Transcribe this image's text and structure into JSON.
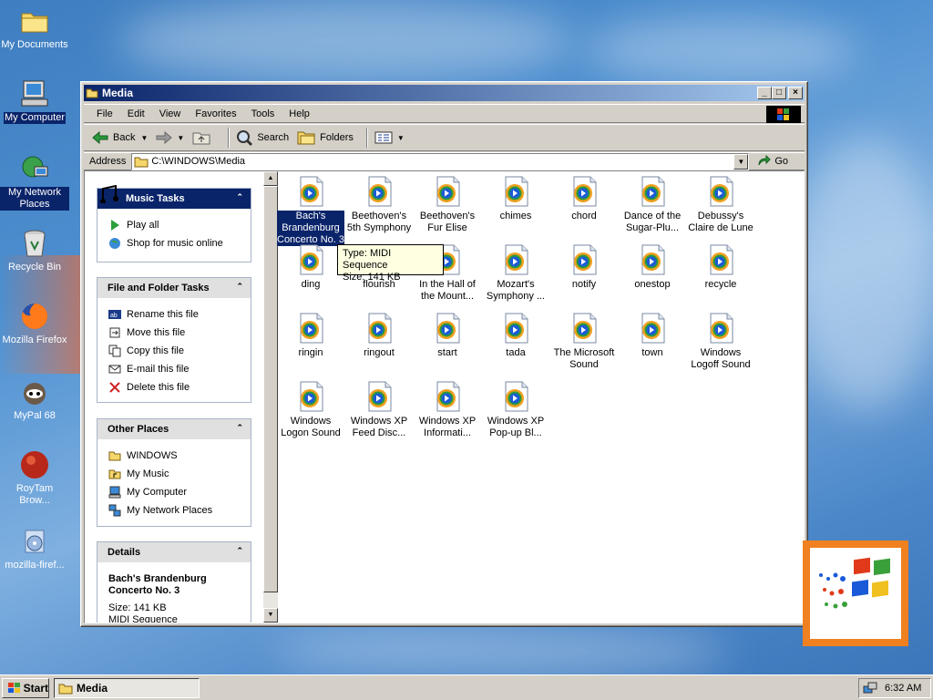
{
  "desktop": {
    "icons": [
      {
        "label": "My Documents",
        "icon": "folder-icon"
      },
      {
        "label": "My Computer",
        "icon": "computer-icon"
      },
      {
        "label": "My Network Places",
        "icon": "network-icon"
      },
      {
        "label": "Recycle Bin",
        "icon": "recycle-bin-icon"
      },
      {
        "label": "Mozilla Firefox",
        "icon": "firefox-icon"
      },
      {
        "label": "MyPal 68",
        "icon": "mypal-icon"
      },
      {
        "label": "RoyTam Brow...",
        "icon": "roytam-icon"
      },
      {
        "label": "mozilla-firef...",
        "icon": "installer-icon"
      }
    ]
  },
  "window": {
    "title": "Media",
    "menu": [
      "File",
      "Edit",
      "View",
      "Favorites",
      "Tools",
      "Help"
    ],
    "toolbar": {
      "back": "Back",
      "search": "Search",
      "folders": "Folders"
    },
    "address": {
      "label": "Address",
      "value": "C:\\WINDOWS\\Media",
      "go": "Go"
    }
  },
  "tasks": {
    "music": {
      "title": "Music Tasks",
      "items": [
        "Play all",
        "Shop for music online"
      ]
    },
    "file": {
      "title": "File and Folder Tasks",
      "items": [
        "Rename this file",
        "Move this file",
        "Copy this file",
        "E-mail this file",
        "Delete this file"
      ]
    },
    "other": {
      "title": "Other Places",
      "items": [
        "WINDOWS",
        "My Music",
        "My Computer",
        "My Network Places"
      ]
    },
    "details": {
      "title": "Details",
      "name": "Bach's Brandenburg Concerto No. 3",
      "size": "Size: 141 KB",
      "type": "MIDI Sequence"
    }
  },
  "files": [
    "Bach's Brandenburg Concerto No. 3",
    "Beethoven's 5th Symphony",
    "Beethoven's Fur Elise",
    "chimes",
    "chord",
    "Dance of the Sugar-Plu...",
    "Debussy's Claire de Lune",
    "ding",
    "flourish",
    "In the Hall of the Mount...",
    "Mozart's Symphony ...",
    "notify",
    "onestop",
    "recycle",
    "ringin",
    "ringout",
    "start",
    "tada",
    "The Microsoft Sound",
    "town",
    "Windows Logoff Sound",
    "Windows Logon Sound",
    "Windows XP Feed Disc...",
    "Windows XP Informati...",
    "Windows XP Pop-up Bl..."
  ],
  "tooltip": {
    "type": "Type: MIDI Sequence",
    "size": "Size: 141 KB"
  },
  "taskbar": {
    "start": "Start",
    "task": "Media",
    "clock": "6:32 AM"
  },
  "colors": {
    "titlebar": "#0a246a",
    "selection": "#0a246a",
    "logo_frame": "#f08020"
  }
}
